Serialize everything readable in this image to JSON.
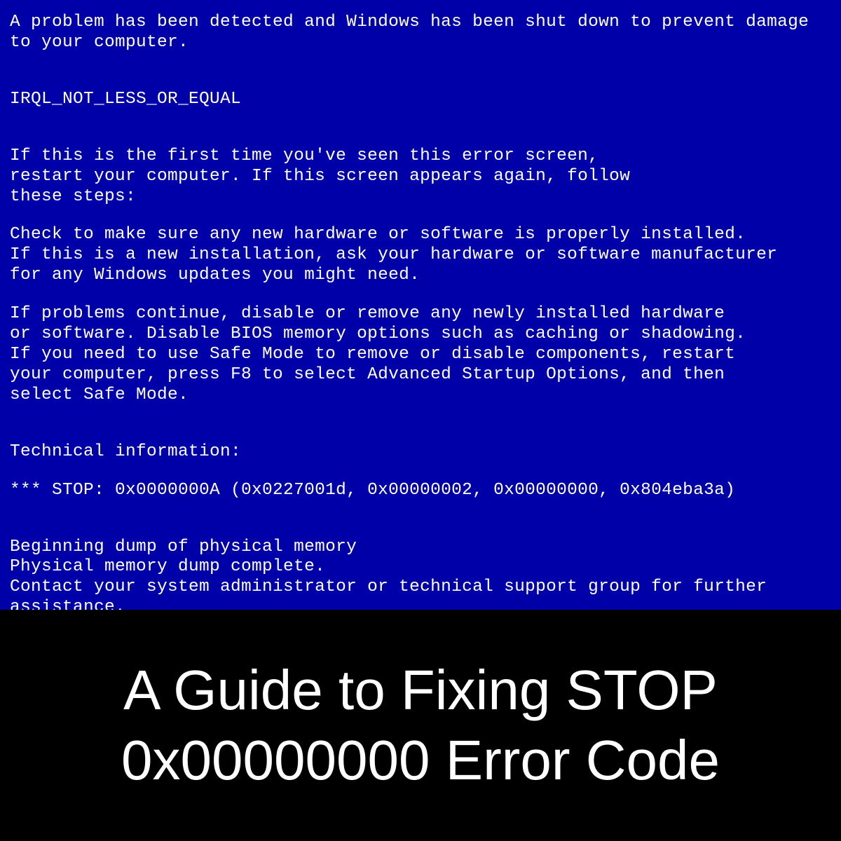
{
  "bsod": {
    "intro": "A problem has been detected and Windows has been shut down to prevent damage to your computer.",
    "error_name": "IRQL_NOT_LESS_OR_EQUAL",
    "first_time": "If this is the first time you've seen this error screen,\nrestart your computer. If this screen appears again, follow\nthese steps:",
    "check_hw": "Check to make sure any new hardware or software is properly installed.\nIf this is a new installation, ask your hardware or software manufacturer\nfor any Windows updates you might need.",
    "problems_continue": "If problems continue, disable or remove any newly installed hardware\nor software. Disable BIOS memory options such as caching or shadowing.\nIf you need to use Safe Mode to remove or disable components, restart\nyour computer, press F8 to select Advanced Startup Options, and then\nselect Safe Mode.",
    "tech_info_label": "Technical information:",
    "stop_line": "*** STOP: 0x0000000A (0x0227001d, 0x00000002, 0x00000000, 0x804eba3a)",
    "dump_begin": "Beginning dump of physical memory",
    "dump_complete": "Physical memory dump complete.",
    "contact": "Contact your system administrator or technical support group for further assistance."
  },
  "caption": {
    "title": "A Guide to Fixing STOP 0x00000000 Error Code"
  }
}
